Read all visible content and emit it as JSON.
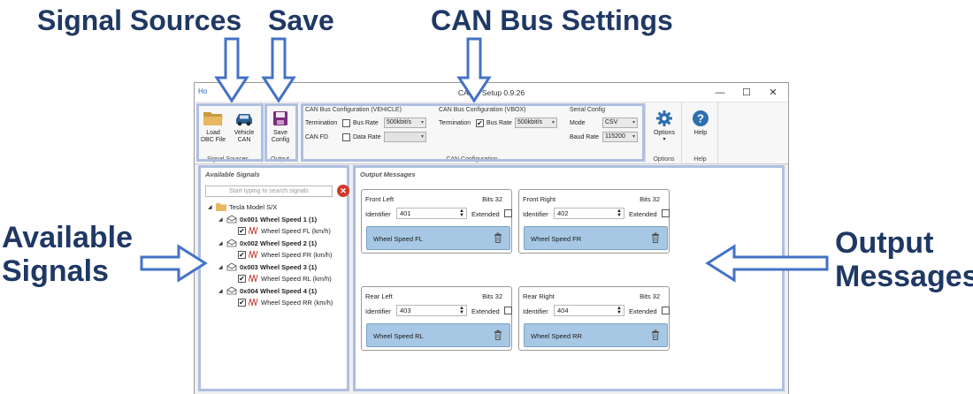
{
  "callouts": {
    "signal_sources": "Signal Sources",
    "save": "Save",
    "can_bus_settings": "CAN Bus Settings",
    "available_signals_1": "Available",
    "available_signals_2": "Signals",
    "output_messages_1": "Output",
    "output_messages_2": "Messages",
    "color": "#1f3864",
    "arrow_color": "#4472c4"
  },
  "window": {
    "title": "CAN         y Setup 0.9.26",
    "home_tab": "Ho",
    "controls": [
      "—",
      "☐",
      "✕"
    ]
  },
  "ribbon": {
    "load_dbc": "Load\nDBC File",
    "load_dbc_l1": "Load",
    "load_dbc_l2": "DBC File",
    "vehicle_can_l1": "Vehicle",
    "vehicle_can_l2": "CAN",
    "signal_sources_label": "Signal Sources",
    "save_config_l1": "Save",
    "save_config_l2": "Config",
    "output_label": "Output",
    "vehicle_title": "CAN Bus Configuration (VEHICLE)",
    "vbox_title": "CAN Bus Configuration (VBOX)",
    "serial_title": "Serial Config",
    "termination": "Termination",
    "bus_rate": "Bus Rate",
    "can_fd": "CAN FD",
    "data_rate": "Data Rate",
    "vehicle_bus_rate": "500kbit/s",
    "vbox_bus_rate": "500kbit/s",
    "mode": "Mode",
    "mode_value": "CSV",
    "baud_rate": "Baud Rate",
    "baud_value": "115200",
    "can_config_label": "CAN Configuration",
    "options": "Options",
    "options_group": "Options",
    "help": "Help",
    "help_group": "Help",
    "vbox_termination_checked": "✔"
  },
  "available": {
    "title": "Available Signals",
    "search_placeholder": "Start typing to search signals",
    "root": "Tesla Model S/X",
    "nodes": [
      {
        "id": "0x001 Wheel Speed 1 (1)",
        "signal": "Wheel Speed FL (km/h)"
      },
      {
        "id": "0x002 Wheel Speed 2 (1)",
        "signal": "Wheel Speed FR (km/h)"
      },
      {
        "id": "0x003 Wheel Speed 3 (1)",
        "signal": "Wheel Speed RL (km/h)"
      },
      {
        "id": "0x004 Wheel Speed 4 (1)",
        "signal": "Wheel Speed RR (km/h)"
      }
    ],
    "check": "✔"
  },
  "output": {
    "title": "Output Messages",
    "identifier_label": "Identifier",
    "extended_label": "Extended",
    "messages": [
      {
        "name": "Front Left",
        "bits": "Bits 32",
        "identifier": "401",
        "signal": "Wheel Speed FL"
      },
      {
        "name": "Front Right",
        "bits": "Bits 32",
        "identifier": "402",
        "signal": "Wheel Speed FR"
      },
      {
        "name": "Rear Left",
        "bits": "Bits 32",
        "identifier": "403",
        "signal": "Wheel Speed RL"
      },
      {
        "name": "Rear Right",
        "bits": "Bits 32",
        "identifier": "404",
        "signal": "Wheel Speed RR"
      }
    ]
  }
}
